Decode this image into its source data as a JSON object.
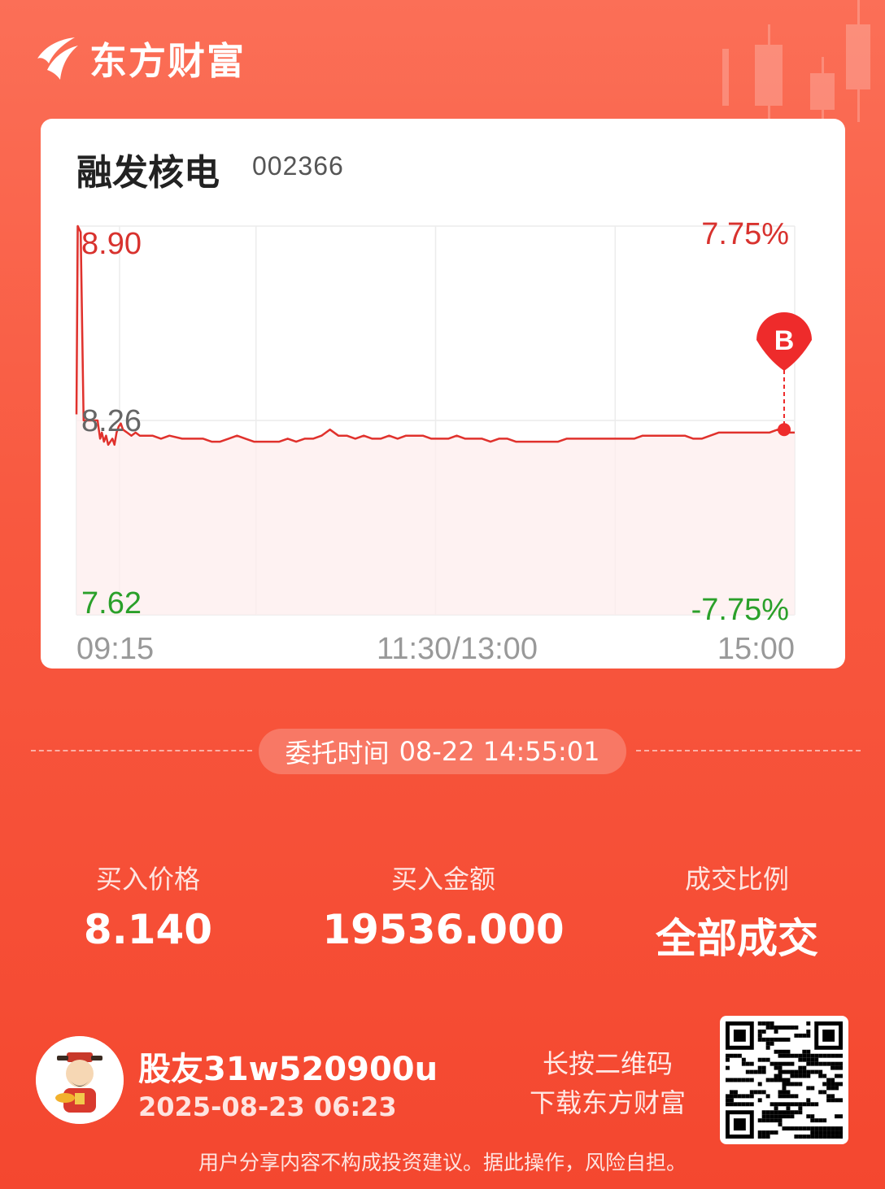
{
  "brand": {
    "name": "东方财富",
    "logo_icon": "eastmoney-logo-icon"
  },
  "stock": {
    "name": "融发核电",
    "code": "002366"
  },
  "chart_data": {
    "type": "line",
    "title": "",
    "xlabel": "",
    "ylabel": "",
    "x_ticks": [
      "09:15",
      "11:30/13:00",
      "15:00"
    ],
    "y_left_ticks": [
      "8.90",
      "8.26",
      "7.62"
    ],
    "y_right_ticks": [
      "7.75%",
      "-7.75%"
    ],
    "ylim": [
      7.62,
      8.9
    ],
    "grid": true,
    "colors": {
      "line": "#e0312c",
      "up_text": "#d8322e",
      "down_text": "#2aa02a",
      "axis_text": "#999999",
      "marker": "#ee2b2b"
    },
    "series": [
      {
        "values": [
          [
            0,
            8.28
          ],
          [
            0.3,
            8.9
          ],
          [
            1.0,
            8.88
          ],
          [
            1.7,
            8.26
          ],
          [
            2.5,
            8.26
          ],
          [
            3.3,
            8.26
          ],
          [
            4.0,
            8.26
          ],
          [
            5.0,
            8.26
          ],
          [
            5.3,
            8.23
          ],
          [
            5.6,
            8.2
          ],
          [
            6.0,
            8.22
          ],
          [
            6.5,
            8.19
          ],
          [
            7.0,
            8.21
          ],
          [
            7.5,
            8.18
          ],
          [
            8.0,
            8.19
          ],
          [
            8.5,
            8.2
          ],
          [
            9.0,
            8.18
          ],
          [
            9.5,
            8.22
          ],
          [
            10.0,
            8.24
          ],
          [
            10.5,
            8.25
          ],
          [
            11.0,
            8.23
          ],
          [
            12.0,
            8.22
          ],
          [
            13.0,
            8.21
          ],
          [
            14.0,
            8.22
          ],
          [
            15,
            8.21
          ],
          [
            18,
            8.21
          ],
          [
            20,
            8.2
          ],
          [
            22,
            8.21
          ],
          [
            25,
            8.2
          ],
          [
            28,
            8.2
          ],
          [
            30,
            8.2
          ],
          [
            32,
            8.19
          ],
          [
            34,
            8.19
          ],
          [
            36,
            8.2
          ],
          [
            38,
            8.21
          ],
          [
            40,
            8.2
          ],
          [
            42,
            8.19
          ],
          [
            44,
            8.19
          ],
          [
            46,
            8.19
          ],
          [
            48,
            8.19
          ],
          [
            50,
            8.2
          ],
          [
            52,
            8.19
          ],
          [
            54,
            8.2
          ],
          [
            56,
            8.2
          ],
          [
            58,
            8.21
          ],
          [
            60,
            8.23
          ],
          [
            62,
            8.21
          ],
          [
            64,
            8.21
          ],
          [
            66,
            8.2
          ],
          [
            68,
            8.21
          ],
          [
            70,
            8.2
          ],
          [
            72,
            8.2
          ],
          [
            74,
            8.21
          ],
          [
            76,
            8.2
          ],
          [
            78,
            8.21
          ],
          [
            80,
            8.21
          ],
          [
            82,
            8.21
          ],
          [
            84,
            8.2
          ],
          [
            86,
            8.2
          ],
          [
            88,
            8.2
          ],
          [
            90,
            8.21
          ],
          [
            92,
            8.2
          ],
          [
            94,
            8.2
          ],
          [
            96,
            8.2
          ],
          [
            98,
            8.19
          ],
          [
            100,
            8.2
          ],
          [
            102,
            8.2
          ],
          [
            104,
            8.19
          ],
          [
            106,
            8.19
          ],
          [
            108,
            8.19
          ],
          [
            110,
            8.19
          ],
          [
            112,
            8.19
          ],
          [
            114,
            8.19
          ],
          [
            116,
            8.2
          ],
          [
            118,
            8.2
          ],
          [
            120,
            8.2
          ],
          [
            122,
            8.2
          ],
          [
            124,
            8.2
          ],
          [
            126,
            8.2
          ],
          [
            128,
            8.2
          ],
          [
            130,
            8.2
          ],
          [
            132,
            8.2
          ],
          [
            134,
            8.21
          ],
          [
            136,
            8.21
          ],
          [
            138,
            8.21
          ],
          [
            140,
            8.21
          ],
          [
            142,
            8.21
          ],
          [
            144,
            8.21
          ],
          [
            146,
            8.2
          ],
          [
            148,
            8.2
          ],
          [
            150,
            8.21
          ],
          [
            152,
            8.22
          ],
          [
            154,
            8.22
          ],
          [
            156,
            8.22
          ],
          [
            158,
            8.22
          ],
          [
            160,
            8.22
          ],
          [
            162,
            8.22
          ],
          [
            164,
            8.22
          ],
          [
            166,
            8.23
          ],
          [
            168,
            8.22
          ],
          [
            170,
            8.22
          ]
        ]
      }
    ],
    "buy_marker": {
      "label": "B",
      "x": 167.5,
      "y": 8.23
    }
  },
  "order": {
    "label": "委托时间",
    "time": "08-22 14:55:01"
  },
  "stats": [
    {
      "label": "买入价格",
      "value": "8.140"
    },
    {
      "label": "买入金额",
      "value": "19536.000"
    },
    {
      "label": "成交比例",
      "value": "全部成交"
    }
  ],
  "user": {
    "name": "股友31w520900u",
    "timestamp": "2025-08-23 06:23",
    "avatar_icon": "fortune-god-avatar-icon"
  },
  "qr": {
    "hint_line1": "长按二维码",
    "hint_line2": "下载东方财富",
    "icon": "qr-code-icon"
  },
  "disclaimer": "用户分享内容不构成投资建议。据此操作，风险自担。"
}
